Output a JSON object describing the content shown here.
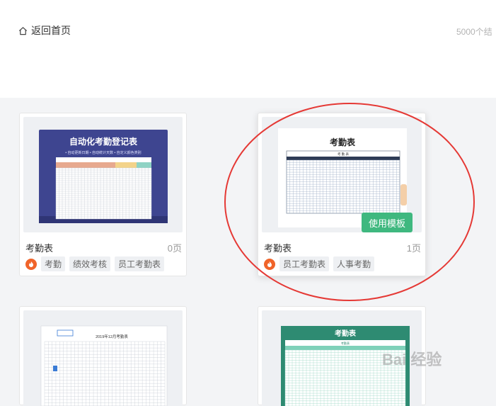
{
  "header": {
    "back_label": "返回首页",
    "result_count": "5000个结"
  },
  "cards": [
    {
      "title": "考勤表",
      "pages": "0页",
      "tags": [
        "考勤",
        "绩效考核",
        "员工考勤表"
      ],
      "thumb_heading": "自动化考勤登记表",
      "thumb_sub": "• 自动更新日期  • 自动统计天数  • 自定义颜色类别"
    },
    {
      "title": "考勤表",
      "pages": "1页",
      "tags": [
        "员工考勤表",
        "人事考勤"
      ],
      "thumb_heading": "考勤表",
      "thumb_inner": "考 勤 表",
      "button_label": "使用模板"
    },
    {
      "thumb_heading": "2019年12月考勤表"
    },
    {
      "thumb_heading": "考勤表",
      "thumb_inner": "考勤表"
    }
  ],
  "watermark": "Bai 经验"
}
